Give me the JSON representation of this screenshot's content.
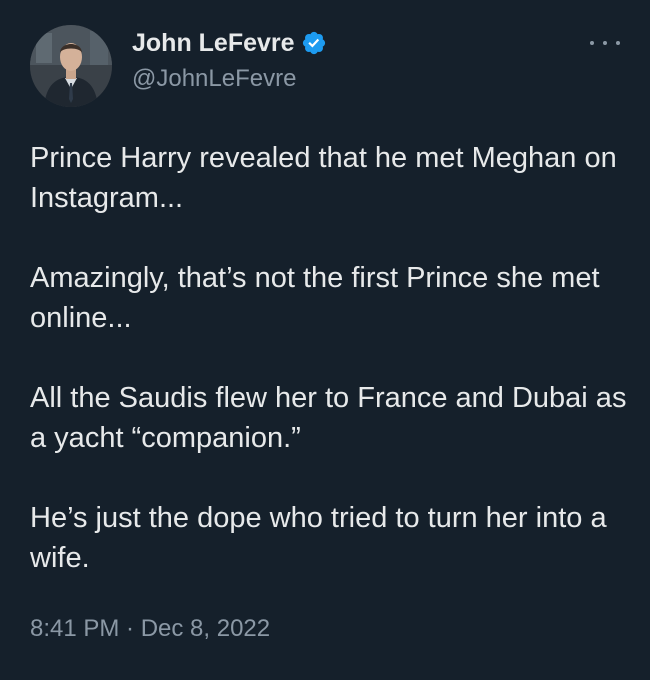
{
  "author": {
    "display_name": "John LeFevre",
    "handle": "@JohnLeFevre",
    "verified_badge_icon": "verified-badge-icon",
    "badge_color": "#1d9bf0"
  },
  "menu": {
    "icon": "more-options-icon"
  },
  "tweet": {
    "paragraphs": [
      "Prince Harry revealed that he met Meghan on Instagram...",
      "Amazingly, that’s not the first Prince she met online...",
      "All the Saudis flew her to France and Dubai as a yacht “companion.”",
      "He’s just the dope who tried to turn her into a wife."
    ],
    "timestamp": "8:41 PM · Dec 8, 2022"
  },
  "colors": {
    "background": "#15202b",
    "text_primary": "#e7e9ea",
    "text_secondary": "#8b98a5"
  }
}
